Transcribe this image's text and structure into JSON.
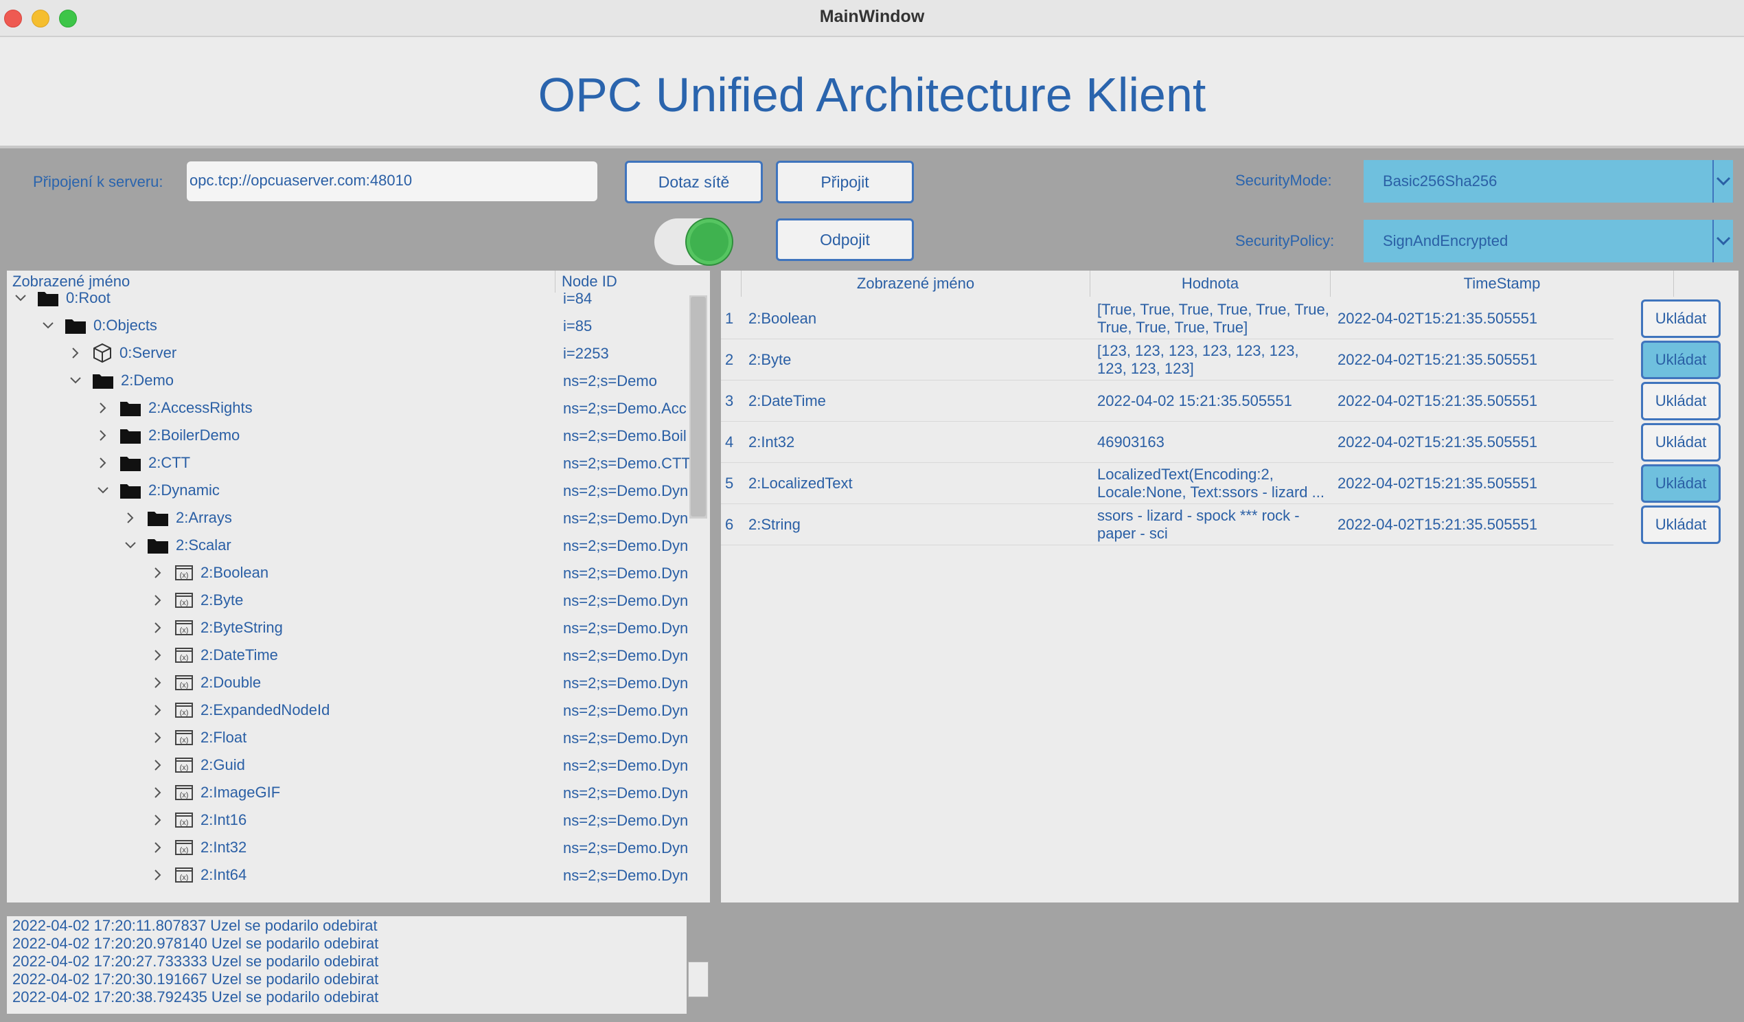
{
  "window": {
    "title": "MainWindow"
  },
  "header": {
    "title": "OPC Unified Architecture Klient"
  },
  "connection": {
    "server_label": "Připojení k serveru:",
    "server_url": "opc.tcp://opcuaserver.com:48010",
    "discover_button": "Dotaz sítě",
    "connect_button": "Připojit",
    "disconnect_button": "Odpojit",
    "toggle_state": "on"
  },
  "security": {
    "mode_label": "SecurityMode:",
    "mode_value": "Basic256Sha256",
    "policy_label": "SecurityPolicy:",
    "policy_value": "SignAndEncrypted"
  },
  "tree": {
    "headers": [
      "Zobrazené jméno",
      "Node ID"
    ],
    "rows": [
      {
        "name": "0:Root",
        "id": "i=84",
        "depth": 0,
        "expanded": true,
        "icon": "folder-icon"
      },
      {
        "name": "0:Objects",
        "id": "i=85",
        "depth": 1,
        "expanded": true,
        "icon": "folder-icon"
      },
      {
        "name": "0:Server",
        "id": "i=2253",
        "depth": 2,
        "expanded": false,
        "icon": "cube-icon"
      },
      {
        "name": "2:Demo",
        "id": "ns=2;s=Demo",
        "depth": 2,
        "expanded": true,
        "icon": "folder-icon"
      },
      {
        "name": "2:AccessRights",
        "id": "ns=2;s=Demo.Acc",
        "depth": 3,
        "expanded": false,
        "icon": "folder-icon"
      },
      {
        "name": "2:BoilerDemo",
        "id": "ns=2;s=Demo.Boil",
        "depth": 3,
        "expanded": false,
        "icon": "folder-icon"
      },
      {
        "name": "2:CTT",
        "id": "ns=2;s=Demo.CTT",
        "depth": 3,
        "expanded": false,
        "icon": "folder-icon"
      },
      {
        "name": "2:Dynamic",
        "id": "ns=2;s=Demo.Dyn",
        "depth": 3,
        "expanded": true,
        "icon": "folder-icon"
      },
      {
        "name": "2:Arrays",
        "id": "ns=2;s=Demo.Dyn",
        "depth": 4,
        "expanded": false,
        "icon": "folder-icon"
      },
      {
        "name": "2:Scalar",
        "id": "ns=2;s=Demo.Dyn",
        "depth": 4,
        "expanded": true,
        "icon": "folder-icon"
      },
      {
        "name": "2:Boolean",
        "id": "ns=2;s=Demo.Dyn",
        "depth": 5,
        "expanded": false,
        "icon": "variable-icon"
      },
      {
        "name": "2:Byte",
        "id": "ns=2;s=Demo.Dyn",
        "depth": 5,
        "expanded": false,
        "icon": "variable-icon"
      },
      {
        "name": "2:ByteString",
        "id": "ns=2;s=Demo.Dyn",
        "depth": 5,
        "expanded": false,
        "icon": "variable-icon"
      },
      {
        "name": "2:DateTime",
        "id": "ns=2;s=Demo.Dyn",
        "depth": 5,
        "expanded": false,
        "icon": "variable-icon"
      },
      {
        "name": "2:Double",
        "id": "ns=2;s=Demo.Dyn",
        "depth": 5,
        "expanded": false,
        "icon": "variable-icon"
      },
      {
        "name": "2:ExpandedNodeId",
        "id": "ns=2;s=Demo.Dyn",
        "depth": 5,
        "expanded": false,
        "icon": "variable-icon"
      },
      {
        "name": "2:Float",
        "id": "ns=2;s=Demo.Dyn",
        "depth": 5,
        "expanded": false,
        "icon": "variable-icon"
      },
      {
        "name": "2:Guid",
        "id": "ns=2;s=Demo.Dyn",
        "depth": 5,
        "expanded": false,
        "icon": "variable-icon"
      },
      {
        "name": "2:ImageGIF",
        "id": "ns=2;s=Demo.Dyn",
        "depth": 5,
        "expanded": false,
        "icon": "variable-icon"
      },
      {
        "name": "2:Int16",
        "id": "ns=2;s=Demo.Dyn",
        "depth": 5,
        "expanded": false,
        "icon": "variable-icon"
      },
      {
        "name": "2:Int32",
        "id": "ns=2;s=Demo.Dyn",
        "depth": 5,
        "expanded": false,
        "icon": "variable-icon"
      },
      {
        "name": "2:Int64",
        "id": "ns=2;s=Demo.Dyn",
        "depth": 5,
        "expanded": false,
        "icon": "variable-icon"
      }
    ]
  },
  "subscriptions": {
    "headers": [
      "Zobrazené jméno",
      "Hodnota",
      "TimeStamp"
    ],
    "rows": [
      {
        "num": "1",
        "name": "2:Boolean",
        "value": "[True, True, True, True, True, True, True, True, True, True]",
        "timestamp": "2022-04-02T15:21:35.505551",
        "button": "Ukládat",
        "button_active": false
      },
      {
        "num": "2",
        "name": "2:Byte",
        "value": "[123, 123, 123, 123, 123, 123, 123, 123, 123]",
        "timestamp": "2022-04-02T15:21:35.505551",
        "button": "Ukládat",
        "button_active": true
      },
      {
        "num": "3",
        "name": "2:DateTime",
        "value": "2022-04-02 15:21:35.505551",
        "timestamp": "2022-04-02T15:21:35.505551",
        "button": "Ukládat",
        "button_active": false
      },
      {
        "num": "4",
        "name": "2:Int32",
        "value": "46903163",
        "timestamp": "2022-04-02T15:21:35.505551",
        "button": "Ukládat",
        "button_active": false
      },
      {
        "num": "5",
        "name": "2:LocalizedText",
        "value": "LocalizedText(Encoding:2, Locale:None, Text:ssors - lizard ...",
        "timestamp": "2022-04-02T15:21:35.505551",
        "button": "Ukládat",
        "button_active": true
      },
      {
        "num": "6",
        "name": "2:String",
        "value": "ssors - lizard - spock *** rock - paper - sci",
        "timestamp": "2022-04-02T15:21:35.505551",
        "button": "Ukládat",
        "button_active": false
      }
    ]
  },
  "log": {
    "lines": [
      "2022-04-02 17:20:11.807837 Uzel se podarilo odebirat",
      "2022-04-02 17:20:20.978140 Uzel se podarilo odebirat",
      "2022-04-02 17:20:27.733333 Uzel se podarilo odebirat",
      "2022-04-02 17:20:30.191667 Uzel se podarilo odebirat",
      "2022-04-02 17:20:38.792435 Uzel se podarilo odebirat"
    ]
  },
  "colors": {
    "text": "#2a5fa5",
    "button_border": "#3f74bd",
    "combo_bg": "#6fc0de",
    "toggle_on": "#3fb24f",
    "active_button_bg": "#6fc0de"
  }
}
